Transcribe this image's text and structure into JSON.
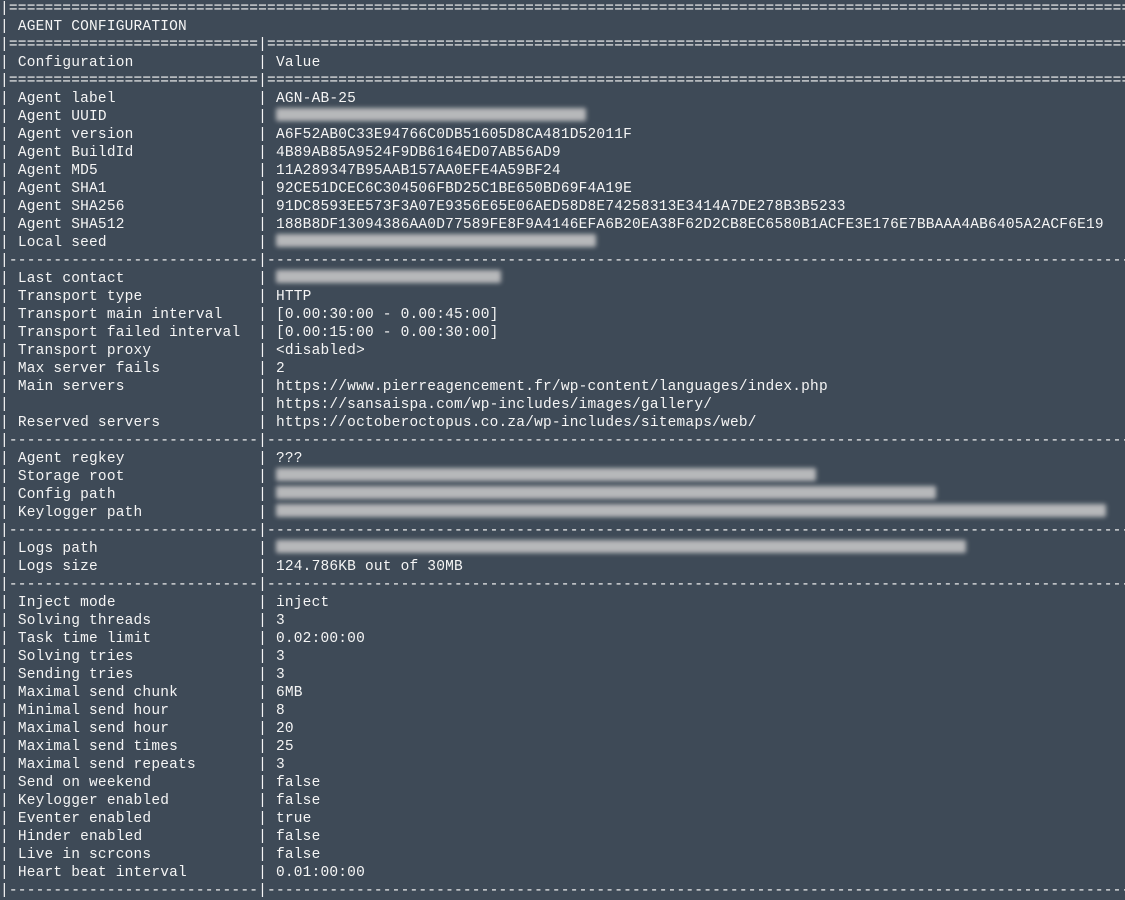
{
  "title": "AGENT CONFIGURATION",
  "headerL": "Configuration",
  "headerR": "Value",
  "sections": [
    {
      "rows": [
        {
          "k": "Agent label",
          "v": "AGN-AB-25"
        },
        {
          "k": "Agent UUID",
          "redact": 310
        },
        {
          "k": "Agent version",
          "v": "A6F52AB0C33E94766C0DB51605D8CA481D52011F"
        },
        {
          "k": "Agent BuildId",
          "v": "4B89AB85A9524F9DB6164ED07AB56AD9"
        },
        {
          "k": "Agent MD5",
          "v": "11A289347B95AAB157AA0EFE4A59BF24"
        },
        {
          "k": "Agent SHA1",
          "v": "92CE51DCEC6C304506FBD25C1BE650BD69F4A19E"
        },
        {
          "k": "Agent SHA256",
          "v": "91DC8593EE573F3A07E9356E65E06AED58D8E74258313E3414A7DE278B3B5233"
        },
        {
          "k": "Agent SHA512",
          "v": "188B8DF13094386AA0D77589FE8F9A4146EFA6B20EA38F62D2CB8EC6580B1ACFE3E176E7BBAAA4AB6405A2ACF6E19"
        },
        {
          "k": "Local seed",
          "redact": 320
        }
      ]
    },
    {
      "rows": [
        {
          "k": "Last contact",
          "redact": 225
        },
        {
          "k": "Transport type",
          "v": "HTTP"
        },
        {
          "k": "Transport main interval",
          "v": "[0.00:30:00 - 0.00:45:00]"
        },
        {
          "k": "Transport failed interval",
          "v": "[0.00:15:00 - 0.00:30:00]"
        },
        {
          "k": "Transport proxy",
          "v": "<disabled>"
        },
        {
          "k": "Max server fails",
          "v": "2"
        },
        {
          "k": "Main servers",
          "v": "https://www.pierreagencement.fr/wp-content/languages/index.php"
        },
        {
          "k": "",
          "v": "https://sansaispa.com/wp-includes/images/gallery/"
        },
        {
          "k": "Reserved servers",
          "v": "https://octoberoctopus.co.za/wp-includes/sitemaps/web/"
        }
      ]
    },
    {
      "rows": [
        {
          "k": "Agent regkey",
          "v": "???"
        },
        {
          "k": "Storage root",
          "redact": 540
        },
        {
          "k": "Config path",
          "redact": 660
        },
        {
          "k": "Keylogger path",
          "redact": 830
        }
      ]
    },
    {
      "rows": [
        {
          "k": "Logs path",
          "redact": 690
        },
        {
          "k": "Logs size",
          "v": "124.786KB out of 30MB"
        }
      ]
    },
    {
      "rows": [
        {
          "k": "Inject mode",
          "v": "inject"
        },
        {
          "k": "Solving threads",
          "v": "3"
        },
        {
          "k": "Task time limit",
          "v": "0.02:00:00"
        },
        {
          "k": "Solving tries",
          "v": "3"
        },
        {
          "k": "Sending tries",
          "v": "3"
        },
        {
          "k": "Maximal send chunk",
          "v": "6MB"
        },
        {
          "k": "Minimal send hour",
          "v": "8"
        },
        {
          "k": "Maximal send hour",
          "v": "20"
        },
        {
          "k": "Maximal send times",
          "v": "25"
        },
        {
          "k": "Maximal send repeats",
          "v": "3"
        },
        {
          "k": "Send on weekend",
          "v": "false"
        },
        {
          "k": "Keylogger enabled",
          "v": "false"
        },
        {
          "k": "Eventer enabled",
          "v": "true"
        },
        {
          "k": "Hinder enabled",
          "v": "false"
        },
        {
          "k": "Live in scrcons",
          "v": "false"
        },
        {
          "k": "Heart beat interval",
          "v": "0.01:00:00"
        }
      ]
    }
  ]
}
